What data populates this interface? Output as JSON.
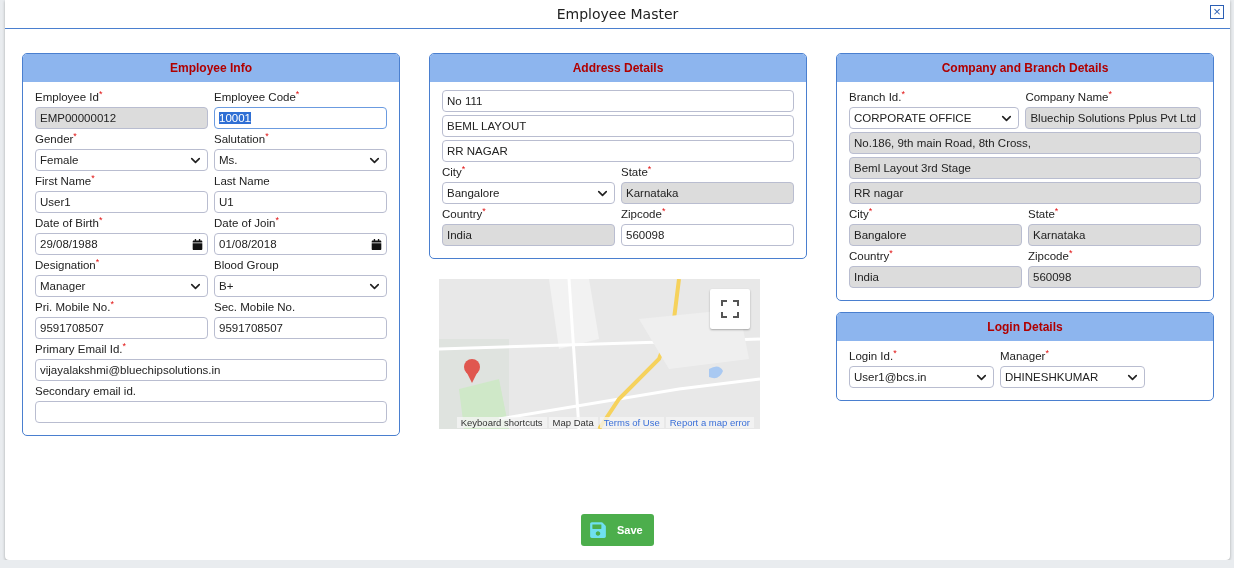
{
  "window": {
    "title": "Employee Master",
    "close": "×"
  },
  "columns": [
    {
      "panels": [
        {
          "title": "Employee Info",
          "kind": "form",
          "rows": [
            [
              {
                "label": "Employee Id$^{*}$",
                "kind": "text",
                "value": "EMP00000012",
                "readonly": true
              },
              {
                "label": "Employee Code$^{*}$",
                "kind": "text",
                "value": "10001",
                "focused": true,
                "text_selected": true
              }
            ],
            [
              {
                "label": "Gender$^{*}$",
                "kind": "select",
                "value": "Female"
              },
              {
                "label": "Salutation$^{*}$",
                "kind": "select",
                "value": "Ms."
              }
            ],
            [
              {
                "label": "First Name$^{*}$",
                "kind": "text",
                "value": "User1"
              },
              {
                "label": "Last Name",
                "kind": "text",
                "value": "U1"
              }
            ],
            [
              {
                "label": "Date of Birth$^{*}$",
                "kind": "date",
                "value": "29/08/1988"
              },
              {
                "label": "Date of Join$^{*}$",
                "kind": "date",
                "value": "01/08/2018"
              }
            ],
            [
              {
                "label": "Designation$^{*}$",
                "kind": "select",
                "value": "Manager"
              },
              {
                "label": "Blood Group",
                "kind": "select",
                "value": "B+"
              }
            ],
            [
              {
                "label": "Pri. Mobile No.$^{*}$",
                "kind": "text",
                "value": "9591708507"
              },
              {
                "label": "Sec. Mobile No.",
                "kind": "text",
                "value": "9591708507"
              }
            ],
            [
              {
                "label": "Primary Email Id.$^{*}$",
                "kind": "text",
                "value": "vijayalakshmi@bluechipsolutions.in"
              }
            ],
            [
              {
                "label": "Secondary email id.",
                "kind": "text"
              }
            ]
          ]
        }
      ]
    },
    {
      "panels": [
        {
          "title": "Address Details",
          "kind": "form",
          "rows": [
            [
              {
                "kind": "text",
                "value": "No 111"
              }
            ],
            [
              {
                "kind": "text",
                "value": "BEML LAYOUT"
              }
            ],
            [
              {
                "kind": "text",
                "value": "RR NAGAR"
              }
            ],
            [
              {
                "label": "City$^{*}$",
                "kind": "select",
                "value": "Bangalore"
              },
              {
                "label": "State$^{*}$",
                "kind": "text",
                "value": "Karnataka",
                "readonly": true
              }
            ],
            [
              {
                "label": "Country$^{*}$",
                "kind": "text",
                "value": "India",
                "readonly": true
              },
              {
                "label": "Zipcode$^{*}$",
                "kind": "text",
                "value": "560098"
              }
            ]
          ]
        }
      ],
      "map": {
        "kind": "picture",
        "links": [
          {
            "text": "Keyboard shortcuts",
            "kind": "plain"
          },
          {
            "text": "Map Data",
            "kind": "plain"
          },
          {
            "text": "Terms of Use",
            "kind": "link"
          },
          {
            "text": "Report a map error",
            "kind": "link"
          }
        ]
      }
    },
    {
      "panels": [
        {
          "title": "Company and Branch Details",
          "kind": "form",
          "rows": [
            [
              {
                "label": "Branch Id.$^{*}$",
                "kind": "select",
                "value": "CORPORATE OFFICE"
              },
              {
                "label": "Company Name$^{*}$",
                "kind": "text",
                "value": "Bluechip Solutions Pplus Pvt Ltd",
                "readonly": true
              }
            ],
            [
              {
                "kind": "text",
                "value": "No.186, 9th main Road, 8th Cross,",
                "readonly": true
              }
            ],
            [
              {
                "kind": "text",
                "value": "Beml Layout 3rd Stage",
                "readonly": true
              }
            ],
            [
              {
                "kind": "text",
                "value": "RR nagar",
                "readonly": true
              }
            ],
            [
              {
                "label": "City$^{*}$",
                "kind": "text",
                "value": "Bangalore",
                "readonly": true
              },
              {
                "label": "State$^{*}$",
                "kind": "text",
                "value": "Karnataka",
                "readonly": true
              }
            ],
            [
              {
                "label": "Country$^{*}$",
                "kind": "text",
                "value": "India",
                "readonly": true
              },
              {
                "label": "Zipcode$^{*}$",
                "kind": "text",
                "value": "560098",
                "readonly": true
              }
            ]
          ]
        },
        {
          "title": "Login Details",
          "kind": "compact",
          "rows": [
            [
              {
                "label": "Login Id.$^{*}$",
                "kind": "select",
                "value": "User1@bcs.in"
              },
              {
                "label": "Manager$^{*}$",
                "kind": "select",
                "value": "DHINESHKUMAR"
              }
            ]
          ]
        }
      ]
    }
  ],
  "save_button": {
    "label": "Save"
  }
}
